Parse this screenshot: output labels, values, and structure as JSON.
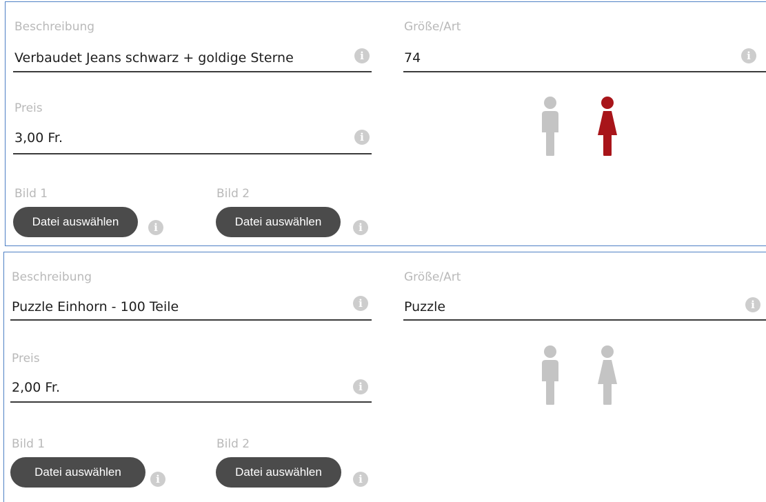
{
  "colors": {
    "card_border": "#4d7fc4",
    "selected_icon": "#a8151a",
    "unselected_icon": "#c4c4c4",
    "button_bg": "#4b4b4b",
    "label_text": "#b9b9b9"
  },
  "items": [
    {
      "description_label": "Beschreibung",
      "description_value": "Verbaudet Jeans schwarz + goldige Sterne",
      "size_label": "Größe/Art",
      "size_value": "74",
      "price_label": "Preis",
      "price_value": "3,00 Fr.",
      "image1_label": "Bild 1",
      "image1_button": "Datei auswählen",
      "image2_label": "Bild 2",
      "image2_button": "Datei auswählen",
      "info_glyph": "i",
      "gender_male_selected": false,
      "gender_female_selected": true
    },
    {
      "description_label": "Beschreibung",
      "description_value": "Puzzle Einhorn - 100 Teile",
      "size_label": "Größe/Art",
      "size_value": "Puzzle",
      "price_label": "Preis",
      "price_value": "2,00 Fr.",
      "image1_label": "Bild 1",
      "image1_button": "Datei auswählen",
      "image2_label": "Bild 2",
      "image2_button": "Datei auswählen",
      "info_glyph": "i",
      "gender_male_selected": false,
      "gender_female_selected": false
    }
  ],
  "icons": {
    "info": "info-icon",
    "male": "male-figure-icon",
    "female": "female-figure-icon"
  }
}
